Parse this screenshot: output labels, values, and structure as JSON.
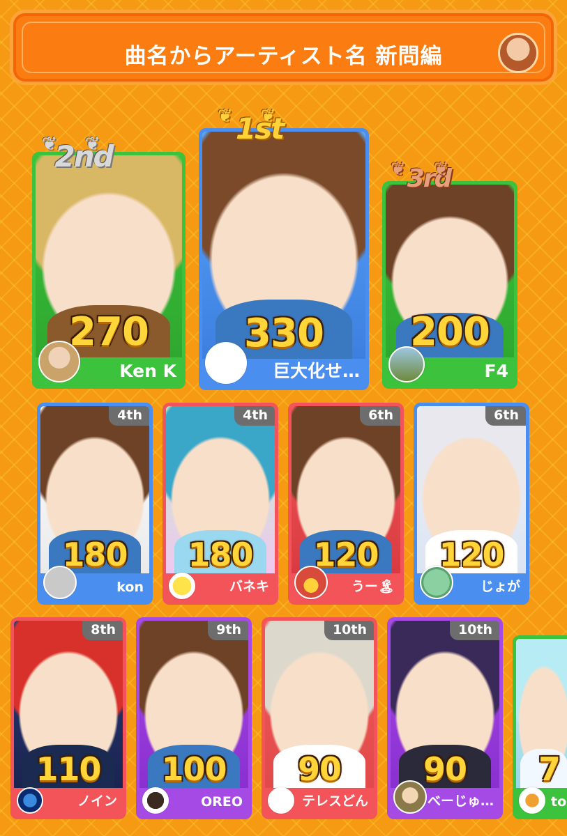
{
  "header": {
    "title": "曲名からアーティスト名 新問編"
  },
  "colors": {
    "green": "#3cc23c",
    "blue": "#4a8ef0",
    "pink": "#f2545a",
    "purple": "#a64ae6",
    "gray_tag": "#6d6d6d",
    "score": "#ffd53a"
  },
  "podium": [
    {
      "rank_label": "2nd",
      "score": "270",
      "name": "Ken K",
      "color": "green"
    },
    {
      "rank_label": "1st",
      "score": "330",
      "name": "巨大化せ…",
      "color": "blue"
    },
    {
      "rank_label": "3rd",
      "score": "200",
      "name": "F4",
      "color": "green"
    }
  ],
  "row2": [
    {
      "rank": "4th",
      "score": "180",
      "name": "kon",
      "color": "blue"
    },
    {
      "rank": "4th",
      "score": "180",
      "name": "バネキ",
      "color": "pink"
    },
    {
      "rank": "6th",
      "score": "120",
      "name": "うー🏝",
      "color": "pink"
    },
    {
      "rank": "6th",
      "score": "120",
      "name": "じょが",
      "color": "blue"
    }
  ],
  "row3": [
    {
      "rank": "8th",
      "score": "110",
      "name": "ノイン",
      "color": "pink"
    },
    {
      "rank": "9th",
      "score": "100",
      "name": "OREO",
      "color": "purple"
    },
    {
      "rank": "10th",
      "score": "90",
      "name": "テレスどん",
      "color": "pink"
    },
    {
      "rank": "10th",
      "score": "90",
      "name": "べーじゅ…",
      "color": "purple"
    },
    {
      "rank": "",
      "score": "7",
      "name": "to",
      "color": "green"
    }
  ]
}
